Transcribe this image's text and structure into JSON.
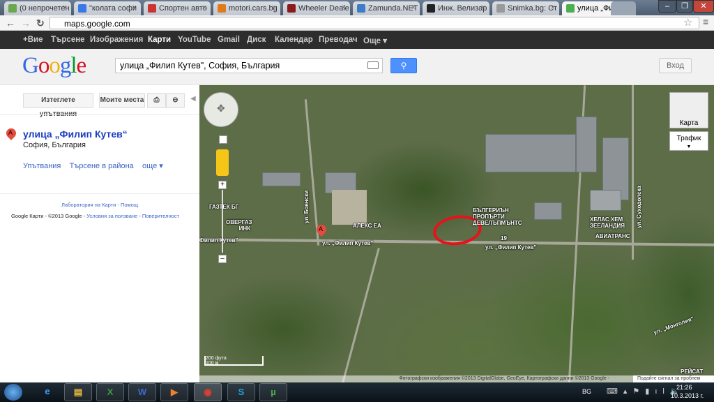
{
  "browser": {
    "tabs": [
      {
        "title": "(0 непрочетен",
        "color": "#6aa84f"
      },
      {
        "title": "\"колата софи",
        "color": "#3b78e7"
      },
      {
        "title": "Спортен авто",
        "color": "#cc3333"
      },
      {
        "title": "motori.cars.bg",
        "color": "#e07b1d"
      },
      {
        "title": "Wheeler Deale",
        "color": "#8b1a1a"
      },
      {
        "title": "Zamunda.NET",
        "color": "#3d7cc9"
      },
      {
        "title": "Инж. Велизар",
        "color": "#222222"
      },
      {
        "title": "Snimka.bg: Ст",
        "color": "#999999"
      },
      {
        "title": "улица „Филип",
        "color": "#4caf50"
      }
    ],
    "url": "maps.google.com"
  },
  "gbar": {
    "items": [
      "+Вие",
      "Търсене",
      "Изображения",
      "Карти",
      "YouTube",
      "Gmail",
      "Диск",
      "Календар",
      "Преводач",
      "Още ▾"
    ]
  },
  "header": {
    "logo": "Google",
    "search_value": "улица „Филип Кутев\", София, България",
    "login": "Вход"
  },
  "left": {
    "btn_directions": "Изтеглете упътвания",
    "btn_myplaces": "Моите места",
    "place_marker": "A",
    "place_title": "улица „Филип Кутев“",
    "place_subtitle": "София, България",
    "links": [
      "Упътвания",
      "Търсене в района",
      "още ▾"
    ],
    "footer_labs": "Лаборатория на Карти",
    "footer_help": "Помощ",
    "footer_copy": "Google Карти - ©2013 Google",
    "footer_terms": "Условия за ползване",
    "footer_privacy": "Поверителност"
  },
  "map": {
    "type_map": "Карта",
    "type_traffic": "Трафик",
    "scale_ft": "200 фута",
    "scale_m": "100 м",
    "marker": "A",
    "labels": [
      "ГАЗТЕК БГ",
      "ОВЕРГАЗ ИНК",
      "АЛЕКС ЕА",
      "БЪЛГЕРИЪН ПРОПЪРТИ ДЕВЕЛЪПМЪНТС",
      "ХЕЛАС ХЕМ ЗЕЕЛАНДИЯ",
      "АВИАТРАНС",
      "ул. „Филип Кутев\"",
      "Филип Кутев\"",
      "ул. „Филип Кутев\"",
      "19",
      "ул. Боянски",
      "ул. Суходолска",
      "ул. „Монголия\"",
      "РЕЙСАТ"
    ],
    "copyright": "Фотографски изображения ©2013 DigitalGlobe, GeoEye, Картографски данни ©2013 Google -",
    "report": "Подайте сигнал за проблем"
  },
  "taskbar": {
    "lang": "BG",
    "time": "21:26",
    "date": "10.3.2013 г."
  }
}
